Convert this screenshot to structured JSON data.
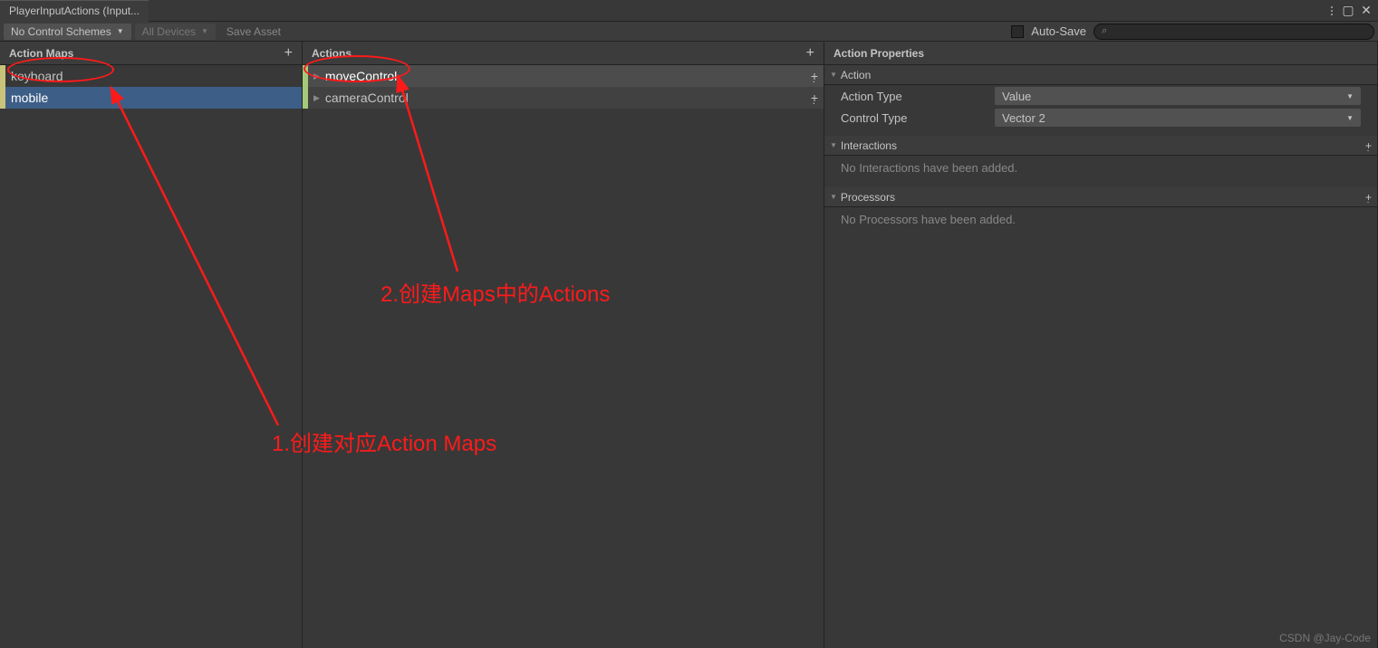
{
  "window": {
    "title": "PlayerInputActions (Input..."
  },
  "toolbar": {
    "schemes": "No Control Schemes",
    "devices": "All Devices",
    "save": "Save Asset",
    "autosave": "Auto-Save"
  },
  "headers": {
    "maps": "Action Maps",
    "actions": "Actions",
    "props": "Action Properties"
  },
  "maps": [
    {
      "name": "keyboard",
      "selected": false
    },
    {
      "name": "mobile",
      "selected": true
    }
  ],
  "actions": [
    {
      "name": "moveControl",
      "selected": true
    },
    {
      "name": "cameraControl",
      "selected": false
    }
  ],
  "props": {
    "action_section": "Action",
    "action_type_label": "Action Type",
    "action_type_value": "Value",
    "control_type_label": "Control Type",
    "control_type_value": "Vector 2",
    "interactions_section": "Interactions",
    "interactions_empty": "No Interactions have been added.",
    "processors_section": "Processors",
    "processors_empty": "No Processors have been added."
  },
  "annotations": {
    "note1": "1.创建对应Action Maps",
    "note2": "2.创建Maps中的Actions"
  },
  "watermark": "CSDN @Jay-Code"
}
